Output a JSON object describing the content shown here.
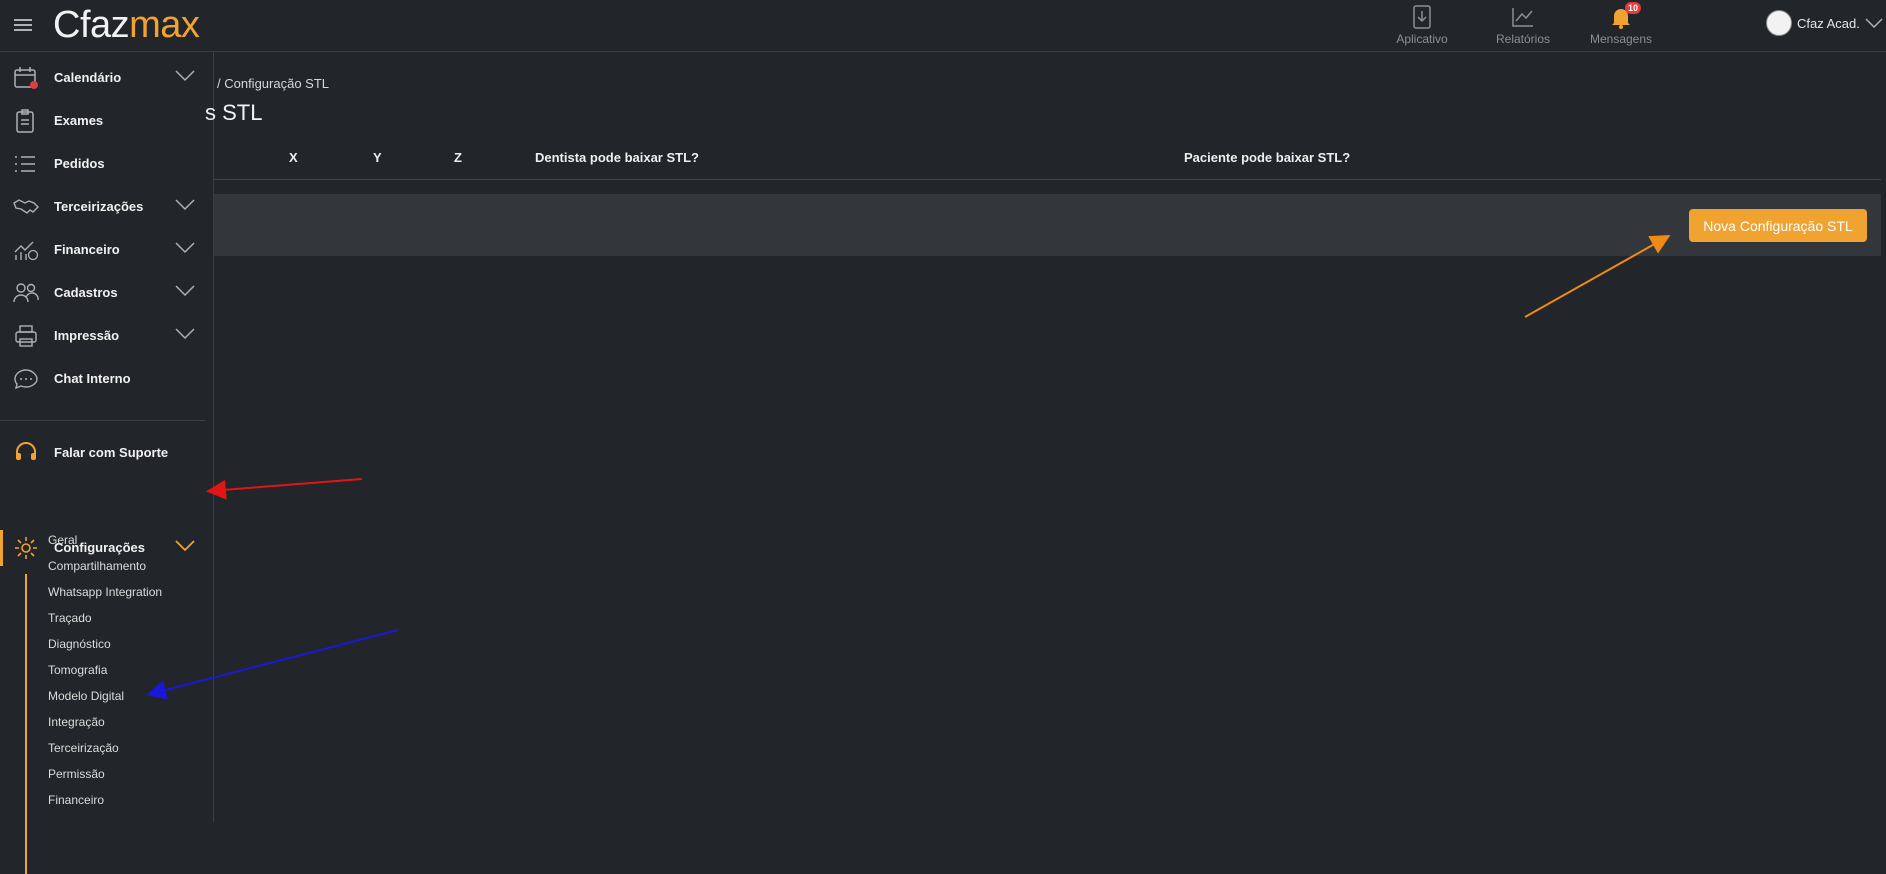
{
  "header": {
    "logo_part1": "Cfaz",
    "logo_part2": "max",
    "nav": [
      {
        "label": "Aplicativo",
        "icon": "download-icon"
      },
      {
        "label": "Relatórios",
        "icon": "chart-icon"
      },
      {
        "label": "Mensagens",
        "icon": "bell-icon",
        "badge": "10"
      }
    ],
    "user_name": "Cfaz Acad."
  },
  "sidebar": {
    "items": [
      {
        "label": "Calendário",
        "icon": "calendar-icon"
      },
      {
        "label": "Exames",
        "icon": "clipboard-icon"
      },
      {
        "label": "Pedidos",
        "icon": "list-icon"
      },
      {
        "label": "Terceirizações",
        "icon": "handshake-icon"
      },
      {
        "label": "Financeiro",
        "icon": "finance-icon"
      },
      {
        "label": "Cadastros",
        "icon": "users-icon"
      },
      {
        "label": "Impressão",
        "icon": "printer-icon"
      },
      {
        "label": "Chat Interno",
        "icon": "chat-icon"
      }
    ],
    "support_label": "Falar com Suporte",
    "config_label": "Configurações",
    "config_subitems": [
      "Geral",
      "Compartilhamento",
      "Whatsapp Integration",
      "Traçado",
      "Diagnóstico",
      "Tomografia",
      "Modelo Digital",
      "Integração",
      "Terceirização",
      "Permissão",
      "Financeiro"
    ]
  },
  "main": {
    "breadcrumb": "/  Configuração STL",
    "title": "s STL",
    "columns": [
      "X",
      "Y",
      "Z",
      "Dentista pode baixar STL?",
      "Paciente pode baixar STL?"
    ],
    "new_button": "Nova Configuração STL"
  },
  "colors": {
    "accent": "#f0a331",
    "background": "#22252a",
    "panel": "#33363b",
    "arrow_red": "#e01515",
    "arrow_orange": "#f08a16",
    "arrow_blue": "#1a18d8"
  }
}
